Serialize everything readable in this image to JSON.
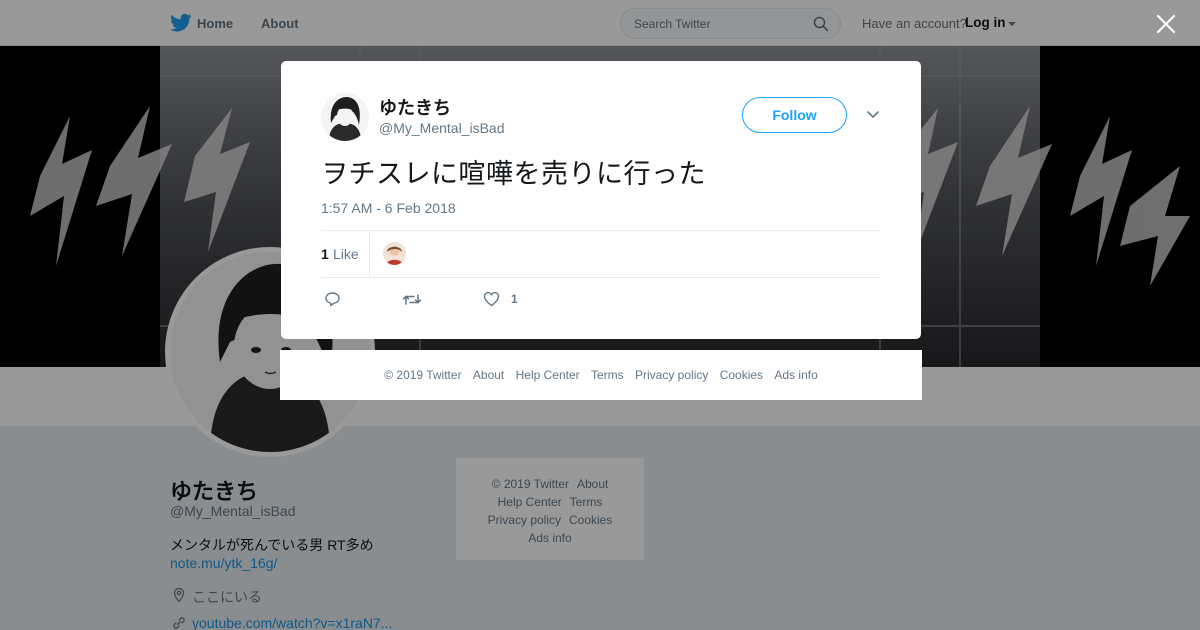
{
  "nav": {
    "home": "Home",
    "about": "About",
    "search_placeholder": "Search Twitter",
    "have_account": "Have an account?",
    "login": "Log in"
  },
  "profile": {
    "name": "ゆたきち",
    "handle": "@My_Mental_isBad",
    "bio": "メンタルが死んでいる男 RT多め",
    "bio_link": "note.mu/ytk_16g/",
    "location": "ここにいる",
    "url": "youtube.com/watch?v=x1raN7..."
  },
  "side_footer": {
    "copyright": "© 2019 Twitter",
    "about": "About",
    "help": "Help Center",
    "terms": "Terms",
    "privacy": "Privacy policy",
    "cookies": "Cookies",
    "ads": "Ads info"
  },
  "tweet": {
    "name": "ゆたきち",
    "handle": "@My_Mental_isBad",
    "follow": "Follow",
    "text": "ヲチスレに喧嘩を売りに行った",
    "timestamp": "1:57 AM - 6 Feb 2018",
    "likes_count": "1",
    "likes_label": "Like",
    "like_action_count": "1"
  },
  "modal_footer": {
    "copyright": "© 2019 Twitter",
    "about": "About",
    "help": "Help Center",
    "terms": "Terms",
    "privacy": "Privacy policy",
    "cookies": "Cookies",
    "ads": "Ads info"
  },
  "colors": {
    "brand_blue": "#1da1f2",
    "link_blue": "#1b95e0",
    "secondary_text": "#657786"
  },
  "icons": [
    "twitter-bird-icon",
    "search-icon",
    "caret-down-icon",
    "close-icon",
    "chevron-down-icon",
    "reply-icon",
    "retweet-icon",
    "heart-icon",
    "location-pin-icon",
    "link-icon"
  ]
}
